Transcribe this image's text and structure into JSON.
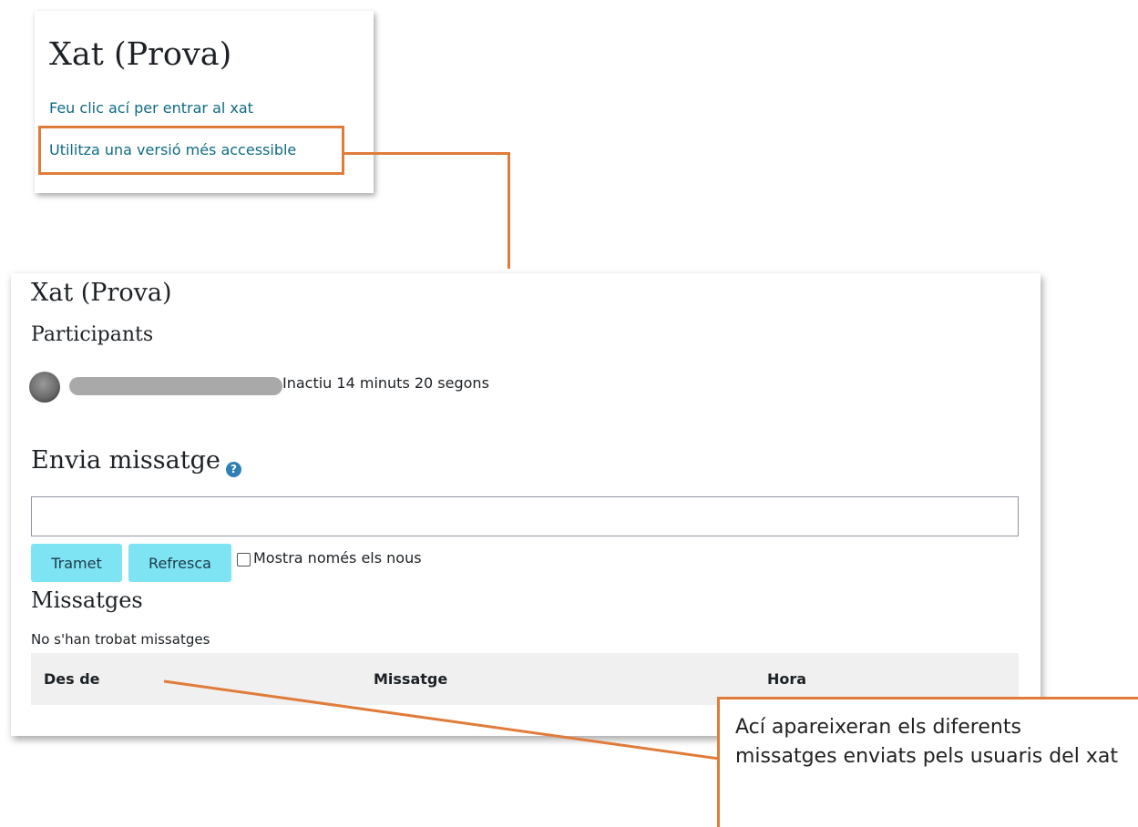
{
  "card1": {
    "title": "Xat (Prova)",
    "enter_link": "Feu clic ací per entrar al xat",
    "accessible_link": "Utilitza una versió més accessible"
  },
  "card2": {
    "title": "Xat (Prova)",
    "participants_heading": "Participants",
    "participant_status": "Inactiu 14 minuts 20 segons",
    "send_heading": "Envia missatge",
    "help_icon": "?",
    "message_input_value": "",
    "send_button": "Tramet",
    "refresh_button": "Refresca",
    "only_new_checkbox": {
      "label": "Mostra només els nous",
      "checked": false
    },
    "messages_heading": "Missatges",
    "no_messages": "No s'han trobat missatges",
    "table_headers": [
      "Des de",
      "Missatge",
      "Hora"
    ]
  },
  "callout": {
    "text": "Ací apareixeran els diferents missatges enviats pels usuaris del xat"
  },
  "colors": {
    "highlight": "#e07c3a",
    "link": "#0f6b85",
    "button": "#7ee3f2"
  }
}
